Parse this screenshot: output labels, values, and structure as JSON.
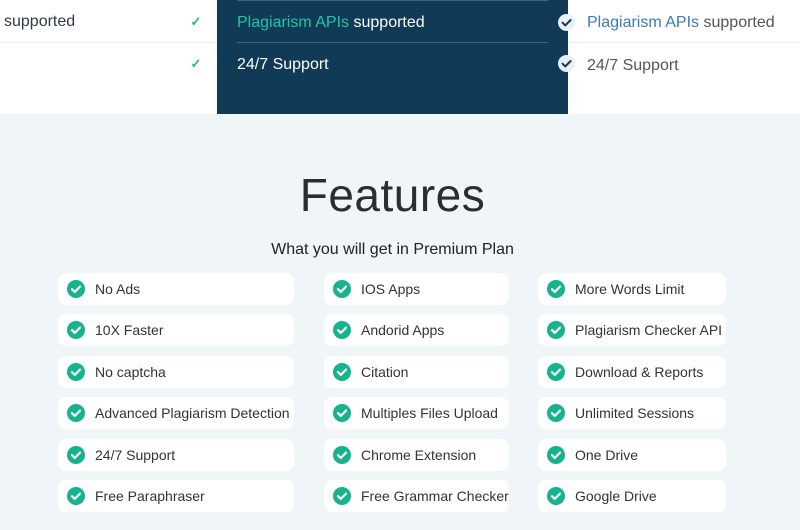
{
  "pricing": {
    "left": {
      "row1": "supported"
    },
    "middle": {
      "row1_accent": "Plagiarism APIs",
      "row1_rest": " supported",
      "row2": "24/7 Support"
    },
    "right": {
      "row1_accent": "Plagiarism APIs",
      "row1_rest": " supported",
      "row2": "24/7 Support"
    }
  },
  "features": {
    "title": "Features",
    "subtitle": "What you will get in Premium Plan",
    "col1": [
      "No Ads",
      "10X Faster",
      "No captcha",
      "Advanced Plagiarism Detection",
      "24/7 Support",
      "Free Paraphraser"
    ],
    "col2": [
      "IOS Apps",
      "Andorid Apps",
      "Citation",
      "Multiples Files Upload",
      "Chrome Extension",
      "Free Grammar Checker"
    ],
    "col3": [
      "More Words Limit",
      "Plagiarism Checker API",
      "Download & Reports",
      "Unlimited Sessions",
      "One Drive",
      "Google Drive"
    ]
  },
  "colors": {
    "check_green": "#17b28e",
    "dark_panel": "#113a57",
    "accent_teal": "#1dc6a8",
    "accent_blue": "#3b7bb8"
  }
}
